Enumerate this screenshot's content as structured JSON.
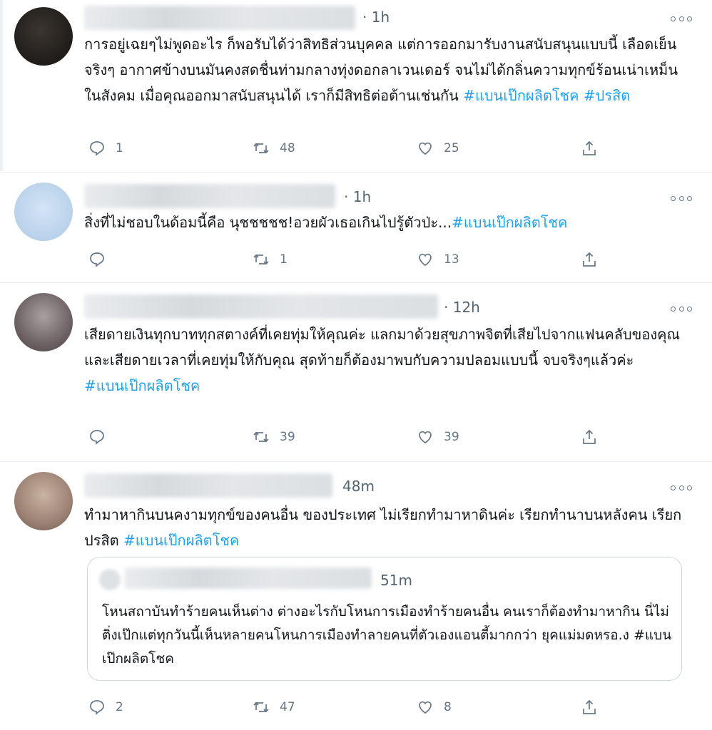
{
  "tweets": [
    {
      "time": "· 1h",
      "text_parts": [
        "การอยู่เฉยๆไม่พูดอะไร ก็พอรับได้ว่าสิทธิส่วนบุคคล แต่การออกมารับงานสนับสนุนแบบนี้ เลือดเย็นจริงๆ อากาศข้างบนมันคงสดชื่นท่ามกลางทุ่งดอกลาเวนเดอร์ จนไม่ได้กลิ่นความทุกข์ร้อนเน่าเหม็นในสังคม เมื่อคุณออกมาสนับสนุนได้ เราก็มีสิทธิต่อต้านเช่นกัน "
      ],
      "hashtags": [
        "#แบนเป๊กผลิตโชค",
        "#ปรสิต"
      ],
      "replies": "1",
      "retweets": "48",
      "likes": "25"
    },
    {
      "time": "· 1h",
      "text_parts": [
        "สิ่งที่ไม่ชอบในด้อมนี้คือ นุชชชชช!อวยผัวเธอเกินไปรู้ตัวป่ะ..."
      ],
      "hashtags": [
        "#แบนเป๊กผลิตโชค"
      ],
      "replies": "",
      "retweets": "1",
      "likes": "13"
    },
    {
      "time": "· 12h",
      "text_parts": [
        "เสียดายเงินทุกบาททุกสตางค์ที่เคยทุ่มให้คุณค่ะ แลกมาด้วยสุขภาพจิตที่เสียไปจากแฟนคลับของคุณและเสียดายเวลาที่เคยทุ่มให้กับคุณ สุดท้ายก็ต้องมาพบกับความปลอมแบบนี้ จบจริงๆแล้วค่ะ"
      ],
      "hashtags": [
        "#แบนเป๊กผลิตโชค"
      ],
      "replies": "",
      "retweets": "39",
      "likes": "39"
    },
    {
      "time": "48m",
      "text_parts": [
        "ทำมาหากินบนคงามทุกข์ของคนอื่น ของประเทศ ไม่เรียกทำมาหาดินค่ะ เรียกทำนาบนหลังคน เรียกปรสิต "
      ],
      "hashtags": [
        "#แบนเป๊กผลิตโชค"
      ],
      "quote": {
        "time": "51m",
        "text": "โหนสถาบันทำร้ายคนเห็นต่าง ต่างอะไรกับโหนการเมืองทำร้ายคนอื่น คนเราก็ต้องทำมาหากิน นี่ไม่ติ่งเป๊กแต่ทุกวันนี้เห็นหลายคนโหนการเมืองทำลายคนที่ตัวเองแอนตี้มากกว่า ยุคแม่มดหรอ.ง #แบนเป๊กผลิตโชค"
      },
      "replies": "2",
      "retweets": "47",
      "likes": "8"
    }
  ],
  "colors": {
    "hashtag": "#1da1f2",
    "icon": "#657786",
    "divider": "#e6ecf0"
  },
  "icons": [
    "reply-icon",
    "retweet-icon",
    "like-icon",
    "share-icon",
    "more-options-icon"
  ]
}
